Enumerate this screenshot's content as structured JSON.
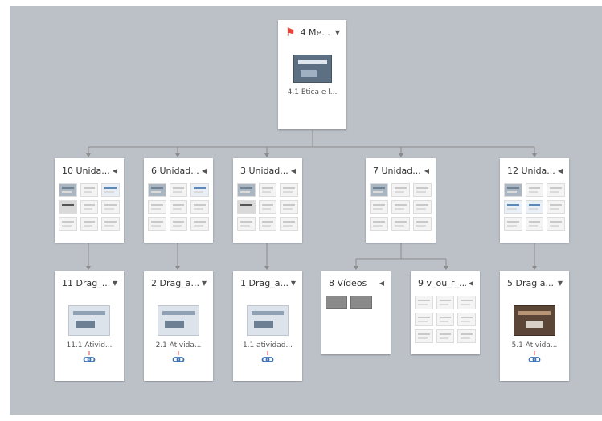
{
  "nodes": {
    "root": {
      "title": "4 Me...",
      "caption": "4.1 Ética e l..."
    },
    "u10": {
      "title": "10 Unida..."
    },
    "u6": {
      "title": "6 Unidad..."
    },
    "u3": {
      "title": "3 Unidad..."
    },
    "u7": {
      "title": "7 Unidad..."
    },
    "u12": {
      "title": "12 Unida..."
    },
    "d11": {
      "title": "11 Drag_...",
      "caption": "11.1 Ativid..."
    },
    "d2": {
      "title": "2 Drag_a...",
      "caption": "2.1 Ativida..."
    },
    "d1": {
      "title": "1 Drag_a...",
      "caption": "1.1 atividad..."
    },
    "v8": {
      "title": "8 Vídeos"
    },
    "v9": {
      "title": "9 v_ou_f_..."
    },
    "d5": {
      "title": "5 Drag a...",
      "caption": "5.1 Ativida..."
    }
  },
  "icons": {
    "flag": "flag-icon",
    "link": "link-icon",
    "expand": "chevron-down-icon",
    "collapse": "chevron-left-icon"
  },
  "colors": {
    "background": "#bcc1c8",
    "flag": "#e8423a",
    "link": "#3b6fb6",
    "connector": "#8b8b8b"
  }
}
